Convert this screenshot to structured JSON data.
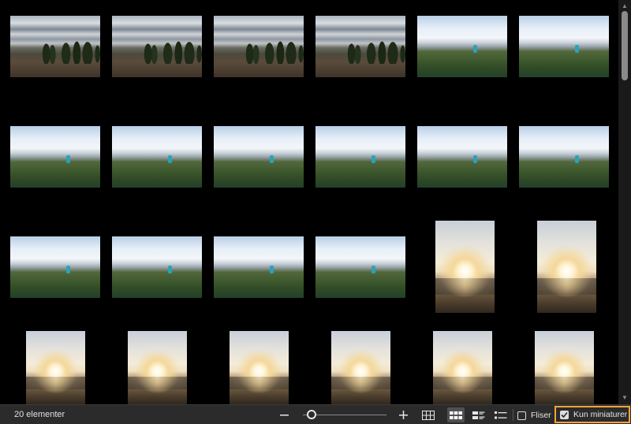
{
  "status": {
    "item_count": "20 elementer",
    "zoom_level_fraction": 0.05,
    "zoom_out_icon": "minus-icon",
    "zoom_in_icon": "plus-icon",
    "views": [
      "grid-tiles-icon",
      "large-thumbnails-icon",
      "content-view-icon",
      "details-view-icon"
    ],
    "active_view": "large-thumbnails-icon",
    "tiles_checkbox": {
      "label": "Fliser",
      "checked": false
    },
    "thumbnails_only_checkbox": {
      "label": "Kun miniaturer",
      "checked": true
    }
  },
  "colors": {
    "highlight": "#f0a33a",
    "background": "#000000",
    "statusbar": "#2b2b2b"
  },
  "photos": [
    {
      "type": "forest"
    },
    {
      "type": "forest"
    },
    {
      "type": "forest"
    },
    {
      "type": "forest"
    },
    {
      "type": "meadow"
    },
    {
      "type": "meadow"
    },
    {
      "type": "meadow"
    },
    {
      "type": "meadow"
    },
    {
      "type": "meadow"
    },
    {
      "type": "meadow"
    },
    {
      "type": "meadow"
    },
    {
      "type": "meadow"
    },
    {
      "type": "meadow"
    },
    {
      "type": "meadow"
    },
    {
      "type": "meadow"
    },
    {
      "type": "meadow"
    },
    {
      "type": "sun"
    },
    {
      "type": "sun"
    },
    {
      "type": "sun"
    },
    {
      "type": "sun"
    },
    {
      "type": "sun"
    },
    {
      "type": "sun"
    },
    {
      "type": "sun"
    },
    {
      "type": "sun"
    }
  ]
}
